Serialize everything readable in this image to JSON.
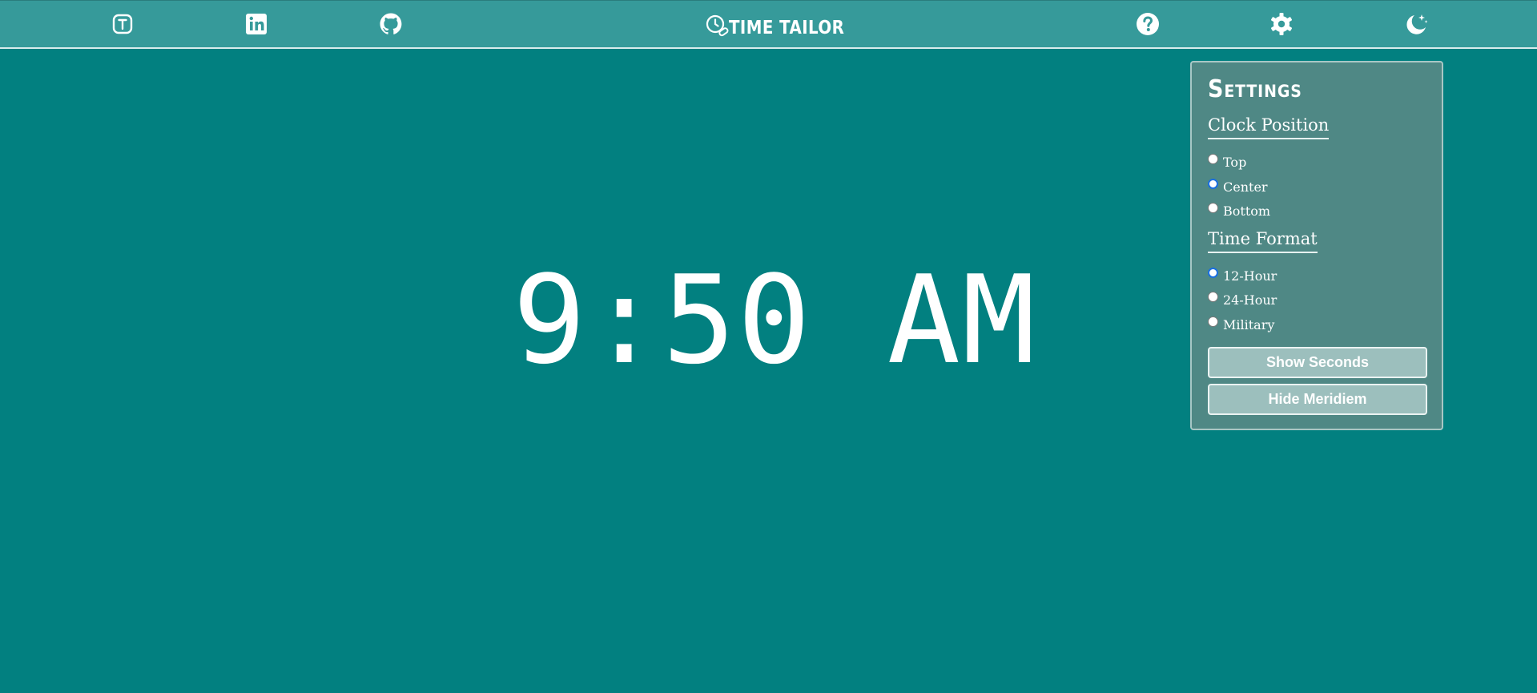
{
  "header": {
    "title": "TIME TAILOR",
    "icons": {
      "left": [
        "tutorial-badge-icon",
        "linkedin-icon",
        "github-icon"
      ],
      "brand": "clock-logo-icon",
      "right": [
        "help-icon",
        "gear-icon",
        "moon-stars-icon"
      ]
    }
  },
  "clock": {
    "time": "9:50 AM"
  },
  "settings": {
    "title": "Settings",
    "clock_position": {
      "heading": "Clock Position",
      "options": [
        "Top",
        "Center",
        "Bottom"
      ],
      "selected": "Center"
    },
    "time_format": {
      "heading": "Time Format",
      "options": [
        "12-Hour",
        "24-Hour",
        "Military"
      ],
      "selected": "12-Hour"
    },
    "buttons": {
      "show_seconds": "Show Seconds",
      "hide_meridiem": "Hide Meridiem"
    }
  },
  "colors": {
    "background": "#028080",
    "topbar": "#369a9a",
    "panel": "#4f8885",
    "button": "#9cbfbd",
    "radio_selected": "#1a6fe0"
  }
}
